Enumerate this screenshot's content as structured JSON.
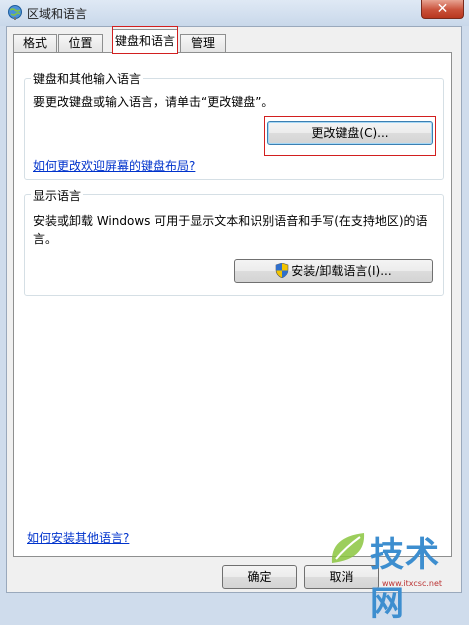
{
  "window": {
    "title": "区域和语言",
    "close_glyph": "✕"
  },
  "tabs": [
    {
      "label": "格式"
    },
    {
      "label": "位置"
    },
    {
      "label": "键盘和语言"
    },
    {
      "label": "管理"
    }
  ],
  "active_tab": "键盘和语言",
  "keyboard_group": {
    "title": "键盘和其他输入语言",
    "description": "要更改键盘或输入语言，请单击“更改键盘”。",
    "change_button": "更改键盘(C)...",
    "help_link": "如何更改欢迎屏幕的键盘布局?"
  },
  "display_group": {
    "title": "显示语言",
    "description_line1": "安装或卸载 Windows 可用于显示文本和识别语音和手写(在支持地区)的语",
    "description_line2": "言。",
    "install_button": "安装/卸载语言(I)...",
    "button_icon": "uac-shield-icon"
  },
  "footer": {
    "install_link": "如何安装其他语言?",
    "ok_button": "确定",
    "cancel_button": "取消"
  },
  "watermark": {
    "text": "技术网",
    "url": "www.itxcsc.net"
  },
  "colors": {
    "highlight_red": "#d21f1f",
    "link_blue": "#0033cc",
    "close_red": "#c9513a"
  }
}
